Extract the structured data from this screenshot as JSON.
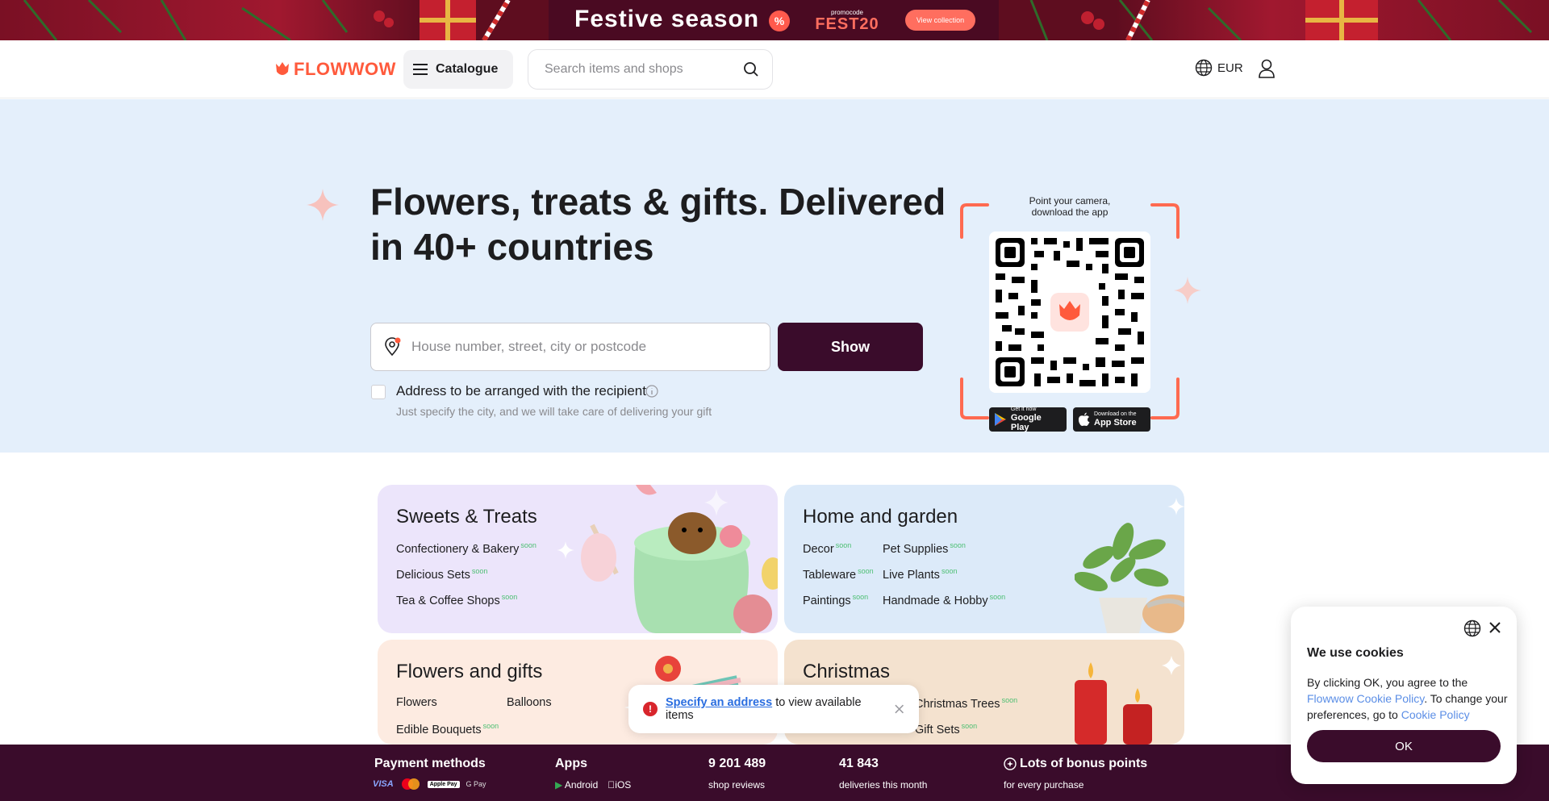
{
  "promo": {
    "title": "Festive season",
    "percent_symbol": "%",
    "code_label": "promocode",
    "code": "FEST20",
    "button": "View collection"
  },
  "header": {
    "logo": "FLOWWOW",
    "catalogue": "Catalogue",
    "search_placeholder": "Search items and shops",
    "currency": "EUR"
  },
  "hero": {
    "title": "Flowers, treats & gifts. Delivered in 40+ countries",
    "address_placeholder": "House number, street, city or postcode",
    "show_button": "Show",
    "arrange_label": "Address to be arranged with the recipient",
    "arrange_sub": "Just specify the city, and we will take care of delivering your gift",
    "qr_caption": "Point your camera, download the app",
    "google_small": "Get it now",
    "google_big": "Google Play",
    "apple_small": "Download on the",
    "apple_big": "App Store"
  },
  "cards": {
    "sweets": {
      "title": "Sweets & Treats",
      "items": [
        "Confectionery & Bakery",
        "Delicious Sets",
        "Tea & Coffee Shops"
      ],
      "soon": "soon"
    },
    "home": {
      "title": "Home and garden",
      "items": [
        "Decor",
        "Pet Supplies",
        "Tableware",
        "Live Plants",
        "Paintings",
        "Handmade & Hobby"
      ],
      "soon": "soon"
    },
    "flowers": {
      "title": "Flowers and gifts",
      "items": [
        "Flowers",
        "Balloons",
        "Edible Bouquets"
      ],
      "soon": "soon"
    },
    "christmas": {
      "title": "Christmas",
      "items": [
        "Christmas Trees",
        "Gift Sets"
      ],
      "soon": "soon"
    }
  },
  "toast": {
    "icon": "!",
    "link": "Specify an address",
    "text": "to view available items"
  },
  "footer": {
    "payment_title": "Payment methods",
    "payment_methods": [
      "VISA",
      "Mastercard",
      "Apple Pay",
      "G Pay"
    ],
    "apps_title": "Apps",
    "apps": [
      "Android",
      "iOS"
    ],
    "reviews_count": "9 201 489",
    "reviews_label": "shop reviews",
    "deliveries_count": "41 843",
    "deliveries_label": "deliveries this month",
    "bonus_title": "Lots of bonus points",
    "bonus_sub": "for every purchase"
  },
  "cookie": {
    "title": "We use cookies",
    "text_before": "By clicking OK, you agree to the ",
    "policy_link": "Flowwow Cookie Policy",
    "text_middle": ". To change your preferences, go to ",
    "policy_link2": "Cookie Policy",
    "ok": "OK"
  },
  "colors": {
    "accent": "#ff5a3c",
    "primary_dark": "#3a0c2b",
    "hero_bg": "#e4effb",
    "soon_green": "#4cbf72"
  }
}
